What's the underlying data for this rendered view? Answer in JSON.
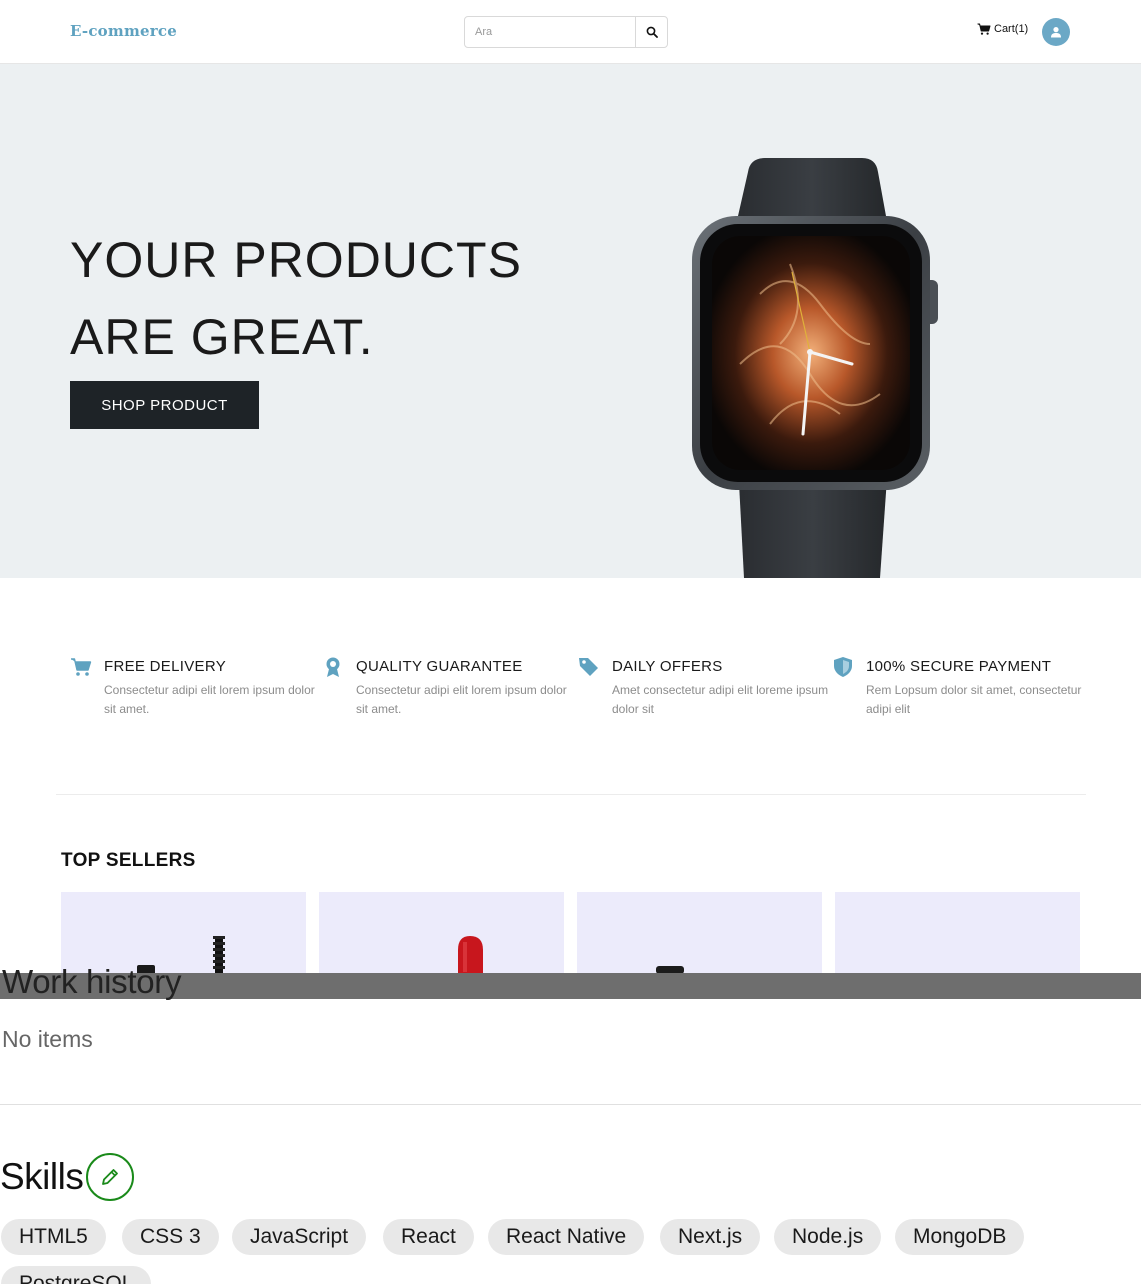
{
  "header": {
    "brand": "E-commerce",
    "search_placeholder": "Ara",
    "cart_label": "Cart(1)"
  },
  "hero": {
    "title_line1": "YOUR PRODUCTS",
    "title_line2": "ARE GREAT.",
    "cta_label": "SHOP PRODUCT"
  },
  "features": [
    {
      "icon": "cart-icon",
      "title": "FREE DELIVERY",
      "desc": "Consectetur adipi elit lorem ipsum dolor sit amet."
    },
    {
      "icon": "badge-icon",
      "title": "QUALITY GUARANTEE",
      "desc": "Consectetur adipi elit lorem ipsum dolor sit amet."
    },
    {
      "icon": "tag-icon",
      "title": "DAILY OFFERS",
      "desc": "Amet consectetur adipi elit loreme ipsum dolor sit"
    },
    {
      "icon": "shield-icon",
      "title": "100% SECURE PAYMENT",
      "desc": "Rem Lopsum dolor sit amet, consectetur adipi elit"
    }
  ],
  "top_sellers": {
    "title": "TOP SELLERS"
  },
  "work_history": {
    "title": "Work history",
    "empty_text": "No items"
  },
  "skills": {
    "title": "Skills",
    "items": [
      "HTML5",
      "CSS 3",
      "JavaScript",
      "React",
      "React Native",
      "Next.js",
      "Node.js",
      "MongoDB",
      "PostgreSQL"
    ]
  },
  "colors": {
    "brand": "#5fa2c0",
    "hero_bg": "#ecf0f2",
    "cta_bg": "#1e2327",
    "card_bg": "#ecebfb",
    "edit_accent": "#1a8a1a"
  }
}
